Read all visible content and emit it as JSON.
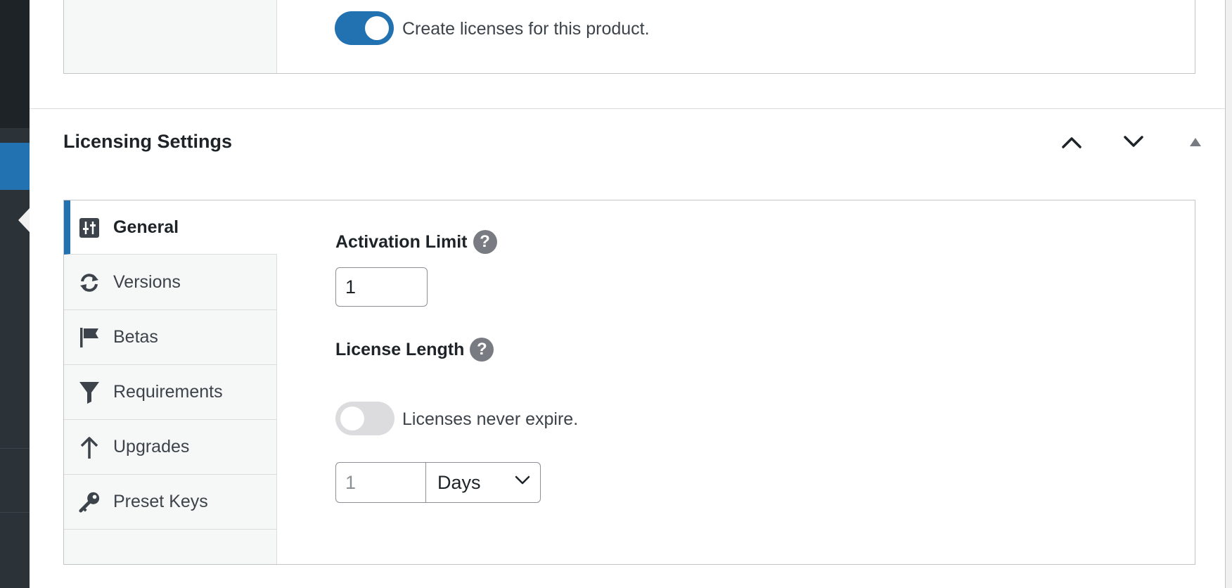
{
  "top_option": {
    "toggle_on": true,
    "label": "Create licenses for this product."
  },
  "section": {
    "title": "Licensing Settings",
    "controls": [
      "move-up",
      "move-down",
      "collapse"
    ]
  },
  "tabs": [
    {
      "label": "General",
      "icon": "sliders-icon",
      "active": true
    },
    {
      "label": "Versions",
      "icon": "update-icon",
      "active": false
    },
    {
      "label": "Betas",
      "icon": "flag-icon",
      "active": false
    },
    {
      "label": "Requirements",
      "icon": "filter-icon",
      "active": false
    },
    {
      "label": "Upgrades",
      "icon": "arrow-up-icon",
      "active": false
    },
    {
      "label": "Preset Keys",
      "icon": "key-icon",
      "active": false
    }
  ],
  "general": {
    "activation_limit": {
      "label": "Activation Limit",
      "value": "1"
    },
    "license_length": {
      "label": "License Length",
      "never_expire_label": "Licenses never expire.",
      "never_expire_on": false,
      "length_placeholder": "1",
      "unit": "Days"
    }
  },
  "colors": {
    "accent": "#2271b1",
    "help_badge": "#787c82",
    "toggle_off": "#dcdcde",
    "admin_menu": "#2c3338"
  }
}
